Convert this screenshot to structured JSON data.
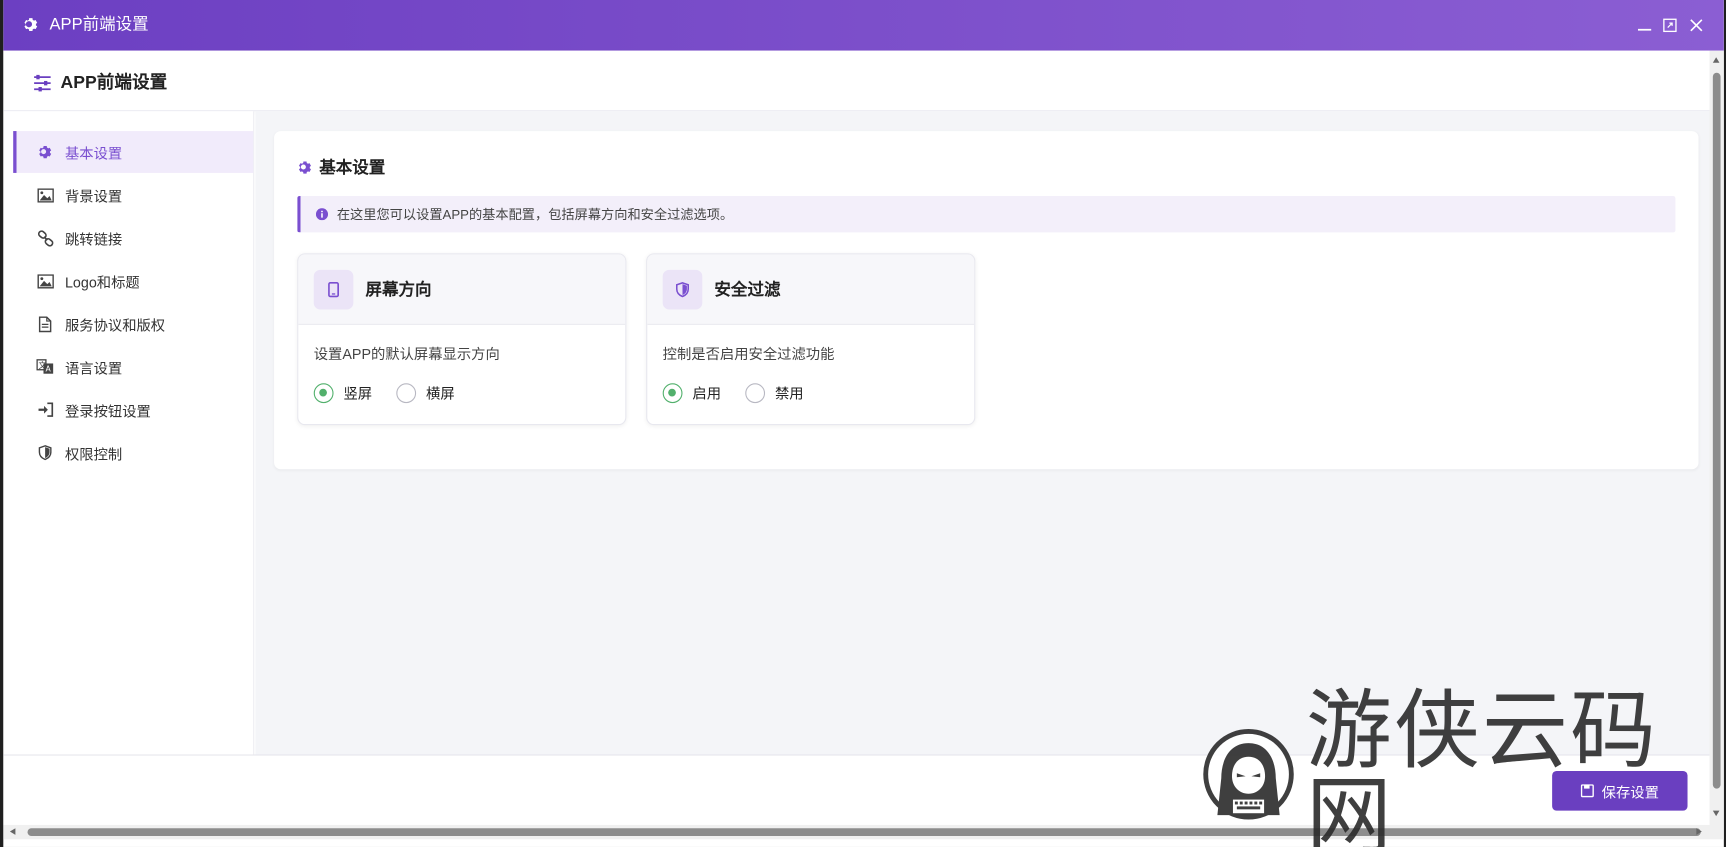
{
  "window": {
    "title": "APP前端设置",
    "controls": {
      "minimize": "minimize-icon",
      "maximize": "maximize-icon",
      "close": "close-icon"
    }
  },
  "header": {
    "title": "APP前端设置",
    "icon": "sliders-icon"
  },
  "sidebar": {
    "items": [
      {
        "label": "基本设置",
        "icon": "gear-icon",
        "active": true
      },
      {
        "label": "背景设置",
        "icon": "image-icon",
        "active": false
      },
      {
        "label": "跳转链接",
        "icon": "link-icon",
        "active": false
      },
      {
        "label": "Logo和标题",
        "icon": "image-icon",
        "active": false
      },
      {
        "label": "服务协议和版权",
        "icon": "document-icon",
        "active": false
      },
      {
        "label": "语言设置",
        "icon": "language-icon",
        "active": false
      },
      {
        "label": "登录按钮设置",
        "icon": "sign-in-icon",
        "active": false
      },
      {
        "label": "权限控制",
        "icon": "shield-icon",
        "active": false
      }
    ]
  },
  "main": {
    "section_title": "基本设置",
    "info_text": "在这里您可以设置APP的基本配置，包括屏幕方向和安全过滤选项。",
    "options": [
      {
        "title": "屏幕方向",
        "icon": "mobile-icon",
        "description": "设置APP的默认屏幕显示方向",
        "choices": [
          {
            "label": "竖屏",
            "checked": true
          },
          {
            "label": "横屏",
            "checked": false
          }
        ]
      },
      {
        "title": "安全过滤",
        "icon": "shield-icon",
        "description": "控制是否启用安全过滤功能",
        "choices": [
          {
            "label": "启用",
            "checked": true
          },
          {
            "label": "禁用",
            "checked": false
          }
        ]
      }
    ]
  },
  "footer": {
    "save_label": "保存设置"
  },
  "watermark": {
    "text": "游侠云码网"
  },
  "colors": {
    "accent": "#7a4fd0",
    "radio_on": "#52b06c",
    "titlebar": "#6c3fc2"
  }
}
